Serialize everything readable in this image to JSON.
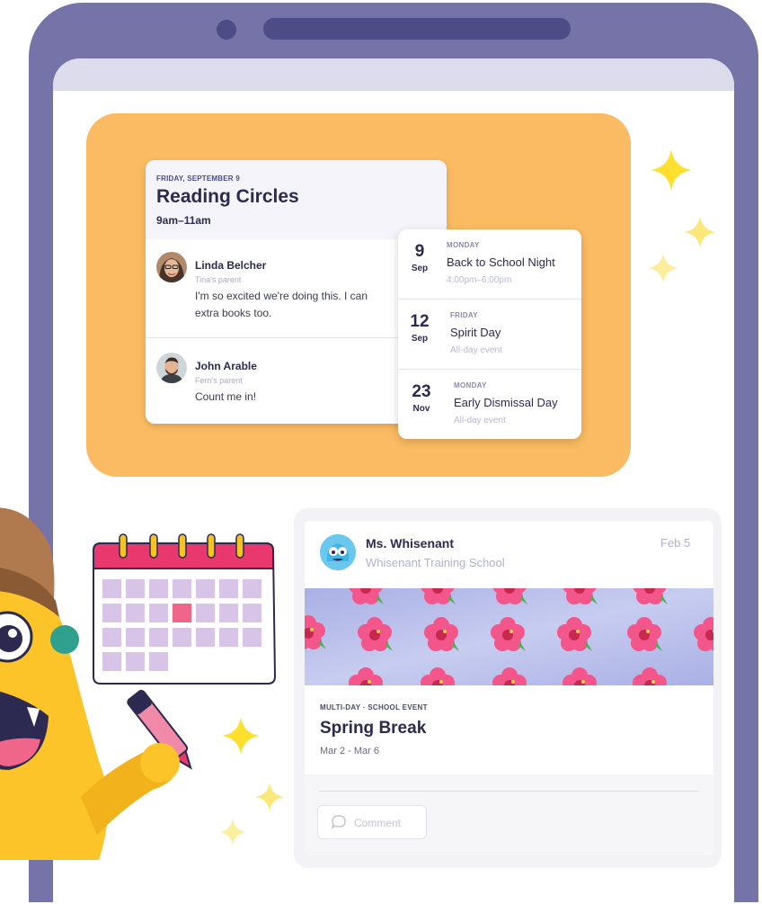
{
  "event_detail": {
    "date_label": "FRIDAY, SEPTEMBER 9",
    "title": "Reading Circles",
    "time": "9am–11am",
    "comments": [
      {
        "name": "Linda Belcher",
        "role": "Tina's parent",
        "text_line1": "I'm so excited we're doing this. I can",
        "text_line2": "extra books too."
      },
      {
        "name": "John Arable",
        "role": "Fern's parent",
        "text_line1": "Count me in!"
      }
    ]
  },
  "events": [
    {
      "day": "9",
      "month": "Sep",
      "weekday": "MONDAY",
      "name": "Back to School Night",
      "time": "4:00pm–6:00pm"
    },
    {
      "day": "12",
      "month": "Sep",
      "weekday": "FRIDAY",
      "name": "Spirit Day",
      "time": "All-day event"
    },
    {
      "day": "23",
      "month": "Nov",
      "weekday": "MONDAY",
      "name": "Early Dismissal Day",
      "time": "All-day event"
    }
  ],
  "post": {
    "author": "Ms. Whisenant",
    "school": "Whisenant Training School",
    "date": "Feb 5",
    "kind": "MULTI-DAY · SCHOOL EVENT",
    "title": "Spring Break",
    "date_range": "Mar 2 - Mar 6",
    "comment_label": "Comment"
  },
  "colors": {
    "device": "#7573a8",
    "panel_orange": "#fbbb62",
    "sparkle": "#fde02e",
    "monster_yellow": "#fcc429",
    "calendar_red": "#e8386d",
    "calendar_cell": "#d8c4e6",
    "calendar_highlight": "#f0668a",
    "flower_pink": "#f2568a",
    "banner_lavender": "#b9c0ea"
  },
  "icons": {
    "sparkle": "sparkle-icon",
    "calendar": "calendar-illustration",
    "comment": "chat-bubble-icon"
  }
}
